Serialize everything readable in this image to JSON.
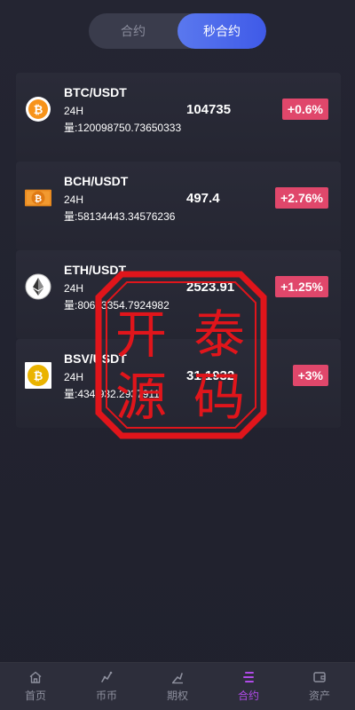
{
  "toggle": {
    "tabs": [
      {
        "label": "合约",
        "active": false
      },
      {
        "label": "秒合约",
        "active": true
      }
    ]
  },
  "markets": [
    {
      "pair": "BTC/USDT",
      "period": "24H",
      "volume": "量:120098750.73650333",
      "price": "104735",
      "change": "+0.6%",
      "icon": "bitcoin-icon"
    },
    {
      "pair": "BCH/USDT",
      "period": "24H",
      "volume": "量:58134443.34576236",
      "price": "497.4",
      "change": "+2.76%",
      "icon": "bitcoin-cash-icon"
    },
    {
      "pair": "ETH/USDT",
      "period": "24H",
      "volume": "量:80673354.7924982",
      "price": "2523.91",
      "change": "+1.25%",
      "icon": "ethereum-icon"
    },
    {
      "pair": "BSV/USDT",
      "period": "24H",
      "volume": "量:434 932.2937911",
      "price": "31.1932",
      "change": "+3%",
      "icon": "bitcoin-sv-icon"
    }
  ],
  "watermark": {
    "chars": [
      "开",
      "泰",
      "源",
      "码"
    ],
    "color": "#e0151b"
  },
  "tabbar": {
    "items": [
      {
        "label": "首页",
        "icon": "home-icon",
        "active": false
      },
      {
        "label": "币币",
        "icon": "trade-icon",
        "active": false
      },
      {
        "label": "期权",
        "icon": "options-icon",
        "active": false
      },
      {
        "label": "合约",
        "icon": "contract-icon",
        "active": true
      },
      {
        "label": "资产",
        "icon": "wallet-icon",
        "active": false
      }
    ]
  },
  "colors": {
    "accent": "#4a66ec",
    "up": "#e0476b",
    "tab_active": "#b04be8"
  }
}
